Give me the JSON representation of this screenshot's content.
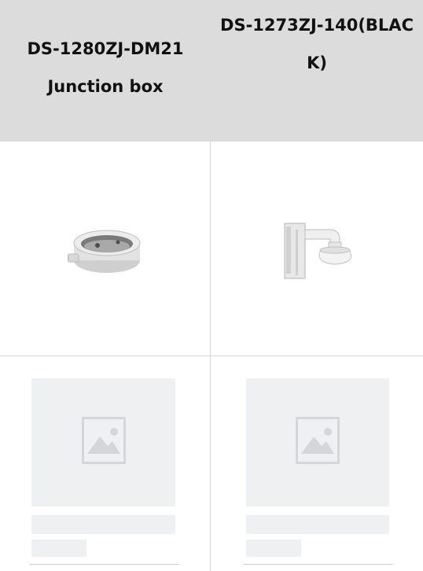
{
  "table": {
    "columns": [
      {
        "lines": [
          "DS-1280ZJ-DM21",
          "Junction box"
        ]
      },
      {
        "text": "DS-1273ZJ-140(BLACK)"
      }
    ]
  },
  "products": [
    {
      "icon": "junction-box-image"
    },
    {
      "icon": "wall-mount-bracket-image"
    }
  ],
  "placeholders": [
    {
      "icon": "image-placeholder-icon"
    },
    {
      "icon": "image-placeholder-icon"
    }
  ]
}
